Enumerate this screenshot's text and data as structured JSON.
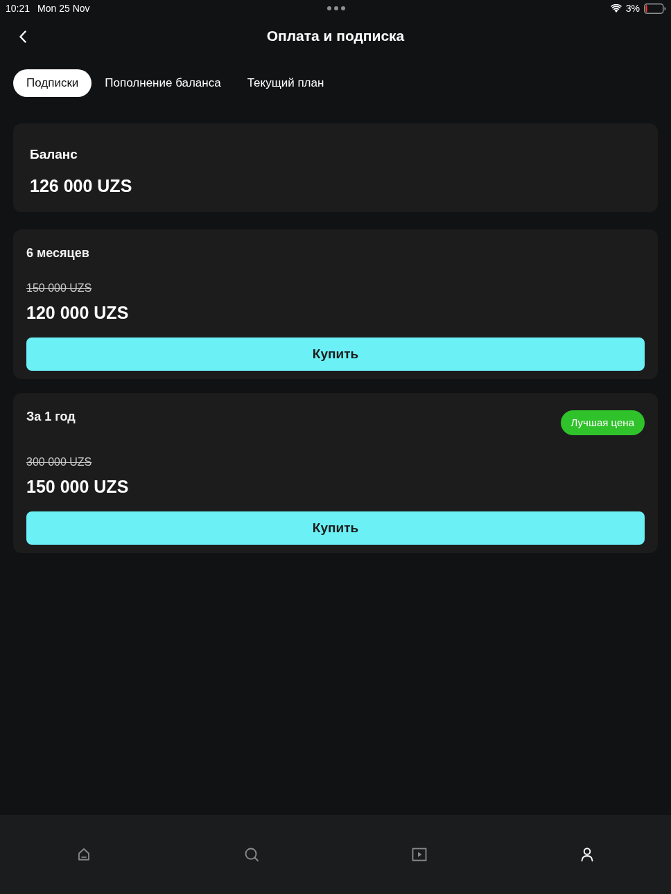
{
  "status_bar": {
    "time": "10:21",
    "date": "Mon 25 Nov",
    "battery": "3%"
  },
  "header": {
    "title": "Оплата и подписка"
  },
  "tabs": [
    {
      "label": "Подписки",
      "selected": true
    },
    {
      "label": "Пополнение баланса",
      "selected": false
    },
    {
      "label": "Текущий план",
      "selected": false
    }
  ],
  "balance": {
    "label": "Баланс",
    "amount": "126 000 UZS"
  },
  "plans": [
    {
      "title": "6 месяцев",
      "old_price": "150 000 UZS",
      "price": "120 000 UZS",
      "button": "Купить"
    },
    {
      "title": "За 1 год",
      "badge": "Лучшая цена",
      "old_price": "300 000 UZS",
      "price": "150 000 UZS",
      "button": "Купить"
    }
  ],
  "bottom_nav": [
    {
      "kind": "home",
      "selected": false
    },
    {
      "kind": "search",
      "selected": false
    },
    {
      "kind": "play",
      "selected": false
    },
    {
      "kind": "profile",
      "selected": true
    }
  ]
}
